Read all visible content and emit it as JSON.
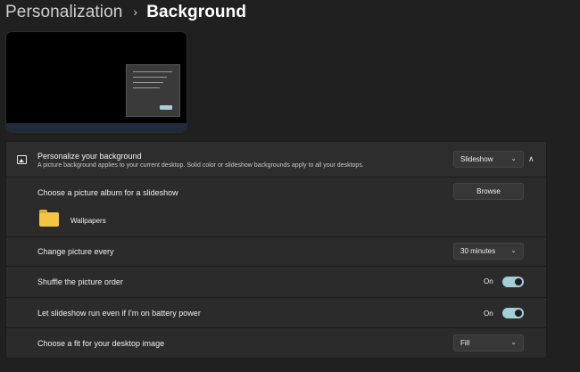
{
  "breadcrumb": {
    "parent": "Personalization",
    "separator": "›",
    "current": "Background"
  },
  "personalize": {
    "title": "Personalize your background",
    "description": "A picture background applies to your current desktop. Solid color or slideshow backgrounds apply to all your desktops.",
    "selected": "Slideshow",
    "icon": "image-icon",
    "expand_icon": "chevron-up-icon"
  },
  "album": {
    "label": "Choose a picture album for a slideshow",
    "button": "Browse",
    "folder_name": "Wallpapers",
    "folder_icon": "folder-icon"
  },
  "interval": {
    "label": "Change picture every",
    "selected": "30 minutes"
  },
  "shuffle": {
    "label": "Shuffle the picture order",
    "state": "On"
  },
  "battery": {
    "label": "Let slideshow run even if I'm on battery power",
    "state": "On"
  },
  "fit": {
    "label": "Choose a fit for your desktop image",
    "selected": "Fill"
  },
  "icons": {
    "dropdown_chevron": "⌄",
    "expand_chevron": "∧"
  },
  "colors": {
    "background": "#202020",
    "card": "#2b2b2b",
    "toggle_on": "#a4cfd6",
    "folder": "#f4c542"
  }
}
